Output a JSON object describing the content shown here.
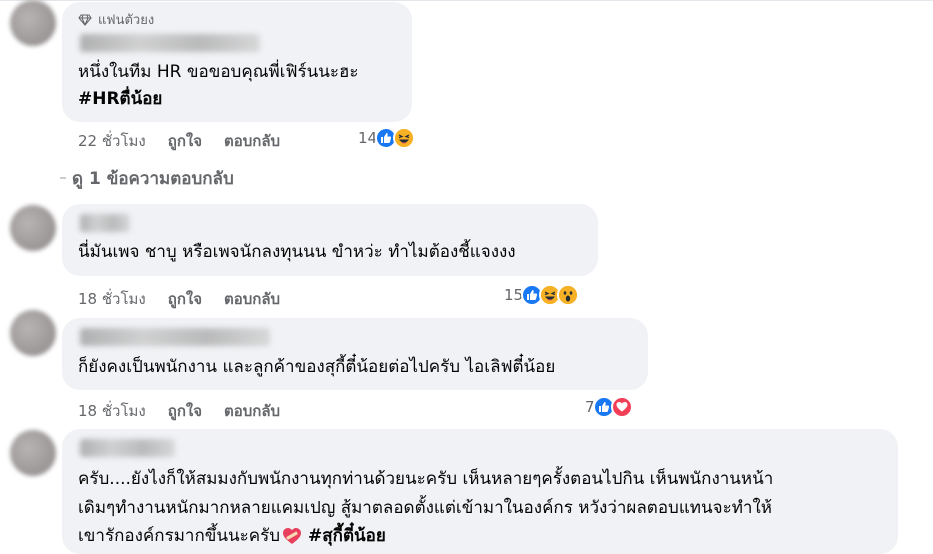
{
  "fan_badge": "แฟนตัวยง",
  "comments": [
    {
      "lines": [
        "หนึ่งในทีม HR ขอขอบคุณพี่เฟิร์นนะฮะ"
      ],
      "hashtag": "#HRตื่น้อย",
      "time": "22 ชั่วโมง",
      "like_label": "ถูกใจ",
      "reply_label": "ตอบกลับ",
      "reaction_count": "14",
      "reactions": [
        "like-icon",
        "haha-icon"
      ]
    },
    {
      "lines": [
        "นี่มันเพจ ชาบู หรือเพจนักลงทุนนน ขำหว่ะ ทำไมต้องชี้แจงงง"
      ],
      "time": "18 ชั่วโมง",
      "like_label": "ถูกใจ",
      "reply_label": "ตอบกลับ",
      "reaction_count": "15",
      "reactions": [
        "like-icon",
        "haha-icon",
        "wow-icon"
      ]
    },
    {
      "lines": [
        "ก็ยังคงเป็นพนักงาน และลูกค้าของสุกี้ตี๋น้อยต่อไปครับ ไอเลิฟตี๋น้อย"
      ],
      "time": "18 ชั่วโมง",
      "like_label": "ถูกใจ",
      "reply_label": "ตอบกลับ",
      "reaction_count": "7",
      "reactions": [
        "like-icon",
        "love-icon"
      ]
    },
    {
      "lines": [
        "ครับ....ยังไงก็ให้สมมงกับพนักงานทุกท่านด้วยนะครับ เห็นหลายๆครั้งตอนไปกิน เห็นพนักงานหน้า",
        "เดิมๆทำงานหนักมากหลายแคมเปญ สู้มาตลอดตั้งแต่เข้ามาในองค์กร หวังว่าผลตอบแทนจะทำให้",
        "เขารักองค์กรมากขึ้นนะครับ"
      ],
      "hashtag": "#สุกี้ตี๋น้อย"
    }
  ],
  "view_replies": "ดู 1 ข้อความตอบกลับ",
  "colors": {
    "bubble": "#f0f2f5",
    "meta": "#65676b",
    "like": "#1877f2",
    "love": "#f33e58",
    "haha": "#f7b125"
  }
}
